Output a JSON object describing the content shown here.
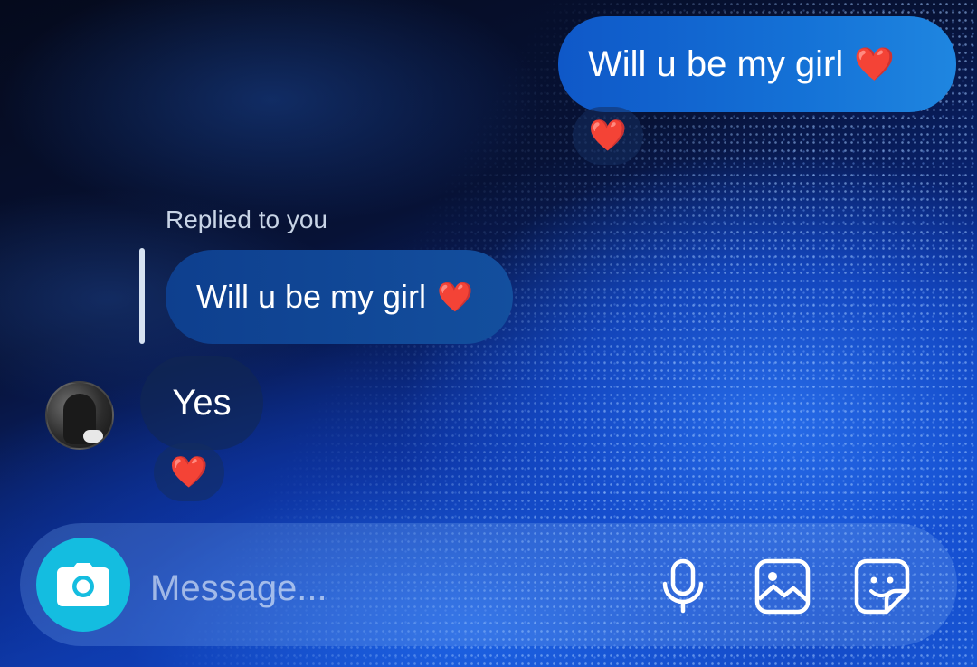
{
  "thread": {
    "sent_message": {
      "text": "Will u be my girl",
      "emoji": "❤️",
      "reaction": "❤️"
    },
    "reply": {
      "label": "Replied to you",
      "quoted_text": "Will u be my girl",
      "quoted_emoji": "❤️"
    },
    "received_message": {
      "text": "Yes",
      "reaction": "❤️"
    }
  },
  "composer": {
    "placeholder": "Message...",
    "value": "",
    "icons": [
      "camera-icon",
      "microphone-icon",
      "gallery-icon",
      "sticker-icon"
    ]
  },
  "colors": {
    "sent_bubble": "#1471d6",
    "camera_button": "#14bde0",
    "background": "#0a2a8a"
  }
}
